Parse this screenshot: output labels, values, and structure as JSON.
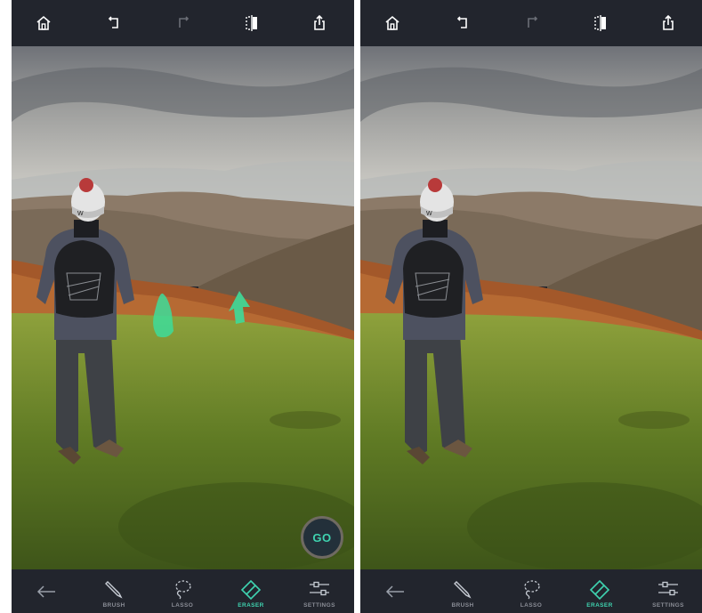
{
  "left": {
    "toolbar": {
      "icons": [
        "home-icon",
        "undo-icon",
        "redo-icon",
        "compare-icon",
        "share-icon"
      ]
    },
    "tools": [
      {
        "label": "BRUSH",
        "icon": "brush-icon"
      },
      {
        "label": "LASSO",
        "icon": "lasso-icon"
      },
      {
        "label": "ERASER",
        "icon": "eraser-icon",
        "active": true
      },
      {
        "label": "SETTINGS",
        "icon": "settings-icon"
      }
    ],
    "go_label": "GO"
  },
  "right": {
    "toolbar": {
      "icons": [
        "home-icon",
        "undo-icon",
        "redo-icon",
        "compare-icon",
        "share-icon"
      ]
    },
    "tools": [
      {
        "label": "BRUSH",
        "icon": "brush-icon"
      },
      {
        "label": "LASSO",
        "icon": "lasso-icon"
      },
      {
        "label": "ERASER",
        "icon": "eraser-icon",
        "active": true
      },
      {
        "label": "SETTINGS",
        "icon": "settings-icon"
      }
    ]
  },
  "colors": {
    "accent": "#3fd3b0",
    "bar": "#22252d",
    "mask": "#3ddc9a"
  }
}
